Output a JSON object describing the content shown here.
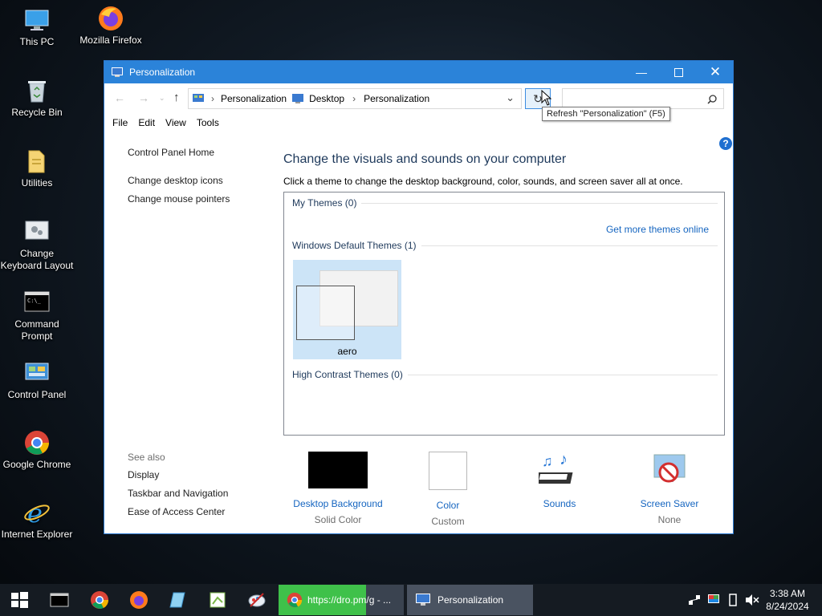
{
  "desktop": {
    "icons": [
      {
        "label": "This PC",
        "icon": "this-pc-icon"
      },
      {
        "label": "Mozilla Firefox",
        "icon": "firefox-icon"
      },
      {
        "label": "Recycle Bin",
        "icon": "recycle-bin-icon"
      },
      {
        "label": "Utilities",
        "icon": "folder-icon"
      },
      {
        "label": "Change Keyboard Layout",
        "icon": "keyboard-layout-icon"
      },
      {
        "label": "Command Prompt",
        "icon": "command-prompt-icon"
      },
      {
        "label": "Control Panel",
        "icon": "control-panel-icon"
      },
      {
        "label": "Google Chrome",
        "icon": "chrome-icon"
      },
      {
        "label": "Internet Explorer",
        "icon": "internet-explorer-icon"
      }
    ]
  },
  "window": {
    "title": "Personalization",
    "breadcrumb": [
      "Personalization",
      "Desktop",
      "Personalization"
    ],
    "tooltip": "Refresh \"Personalization\" (F5)",
    "menu": [
      "File",
      "Edit",
      "View",
      "Tools"
    ],
    "left": {
      "home": "Control Panel Home",
      "links": [
        "Change desktop icons",
        "Change mouse pointers"
      ],
      "see_also_title": "See also",
      "see_also": [
        "Display",
        "Taskbar and Navigation",
        "Ease of Access Center"
      ]
    },
    "main": {
      "heading": "Change the visuals and sounds on your computer",
      "subtitle": "Click a theme to change the desktop background, color, sounds, and screen saver all at once.",
      "my_themes": "My Themes (0)",
      "get_more": "Get more themes online",
      "default_themes": "Windows Default Themes (1)",
      "theme_name": "aero",
      "high_contrast": "High Contrast Themes (0)"
    },
    "bottom": [
      {
        "label": "Desktop Background",
        "value": "Solid Color"
      },
      {
        "label": "Color",
        "value": "Custom"
      },
      {
        "label": "Sounds",
        "value": ""
      },
      {
        "label": "Screen Saver",
        "value": "None"
      }
    ]
  },
  "taskbar": {
    "chrome_task": "https://dro.pm/g - ...",
    "personalization_task": "Personalization",
    "time": "3:38 AM",
    "date": "8/24/2024"
  }
}
